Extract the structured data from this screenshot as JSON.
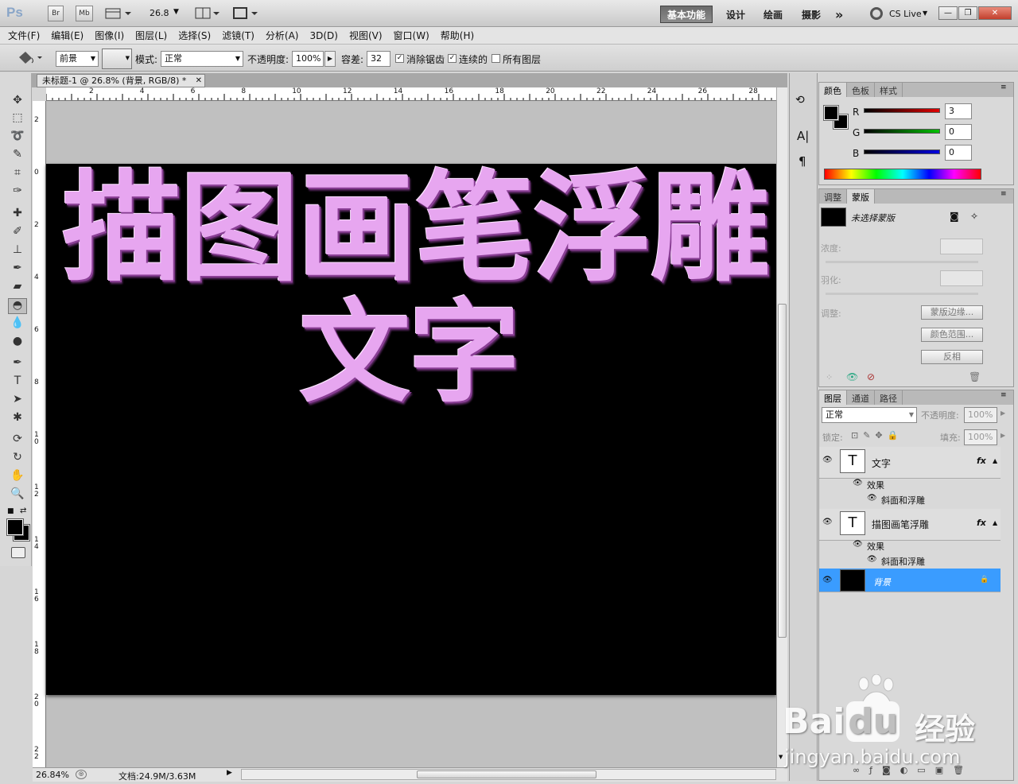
{
  "app": {
    "logo": "Ps",
    "bridge_btn": "Br",
    "minibridge_btn": "Mb",
    "zoom": "26.8",
    "workspaces": [
      "基本功能",
      "设计",
      "绘画",
      "摄影"
    ],
    "more": "»",
    "cs_live": "CS Live",
    "window_controls": [
      "—",
      "❐",
      "✕"
    ]
  },
  "menus": [
    "文件(F)",
    "编辑(E)",
    "图像(I)",
    "图层(L)",
    "选择(S)",
    "滤镜(T)",
    "分析(A)",
    "3D(D)",
    "视图(V)",
    "窗口(W)",
    "帮助(H)"
  ],
  "options": {
    "fill_source": "前景",
    "mode_label": "模式:",
    "mode_value": "正常",
    "opacity_label": "不透明度:",
    "opacity_value": "100%",
    "tolerance_label": "容差:",
    "tolerance_value": "32",
    "antialias_label": "消除锯齿",
    "contiguous_label": "连续的",
    "all_layers_label": "所有图层"
  },
  "document": {
    "tab_title": "未标题-1 @ 26.8% (背景, RGB/8) *",
    "ruler_top": [
      "2",
      "4",
      "6",
      "8",
      "10",
      "12",
      "14",
      "16",
      "18",
      "20",
      "22",
      "24",
      "26",
      "28"
    ],
    "ruler_left": [
      "2",
      "0",
      "2",
      "4",
      "6",
      "8",
      "1 0",
      "1 2",
      "1 4",
      "1 6",
      "1 8",
      "2 0",
      "2 2"
    ],
    "line1": "描图画笔浮雕",
    "line2": "文字",
    "zoom_status": "26.84%",
    "doc_size": "文档:24.9M/3.63M"
  },
  "color_panel": {
    "tabs": [
      "颜色",
      "色板",
      "样式"
    ],
    "channels": [
      {
        "label": "R",
        "value": "3",
        "color": "#e00000"
      },
      {
        "label": "G",
        "value": "0",
        "color": "#00c000"
      },
      {
        "label": "B",
        "value": "0",
        "color": "#0000e0"
      }
    ]
  },
  "mask_panel": {
    "tabs": [
      "调整",
      "蒙版"
    ],
    "title": "未选择蒙版",
    "density_label": "浓度:",
    "feather_label": "羽化:",
    "adjust_label": "调整:",
    "buttons": [
      "蒙版边缘...",
      "颜色范围...",
      "反相"
    ]
  },
  "layers_panel": {
    "tabs": [
      "图层",
      "通道",
      "路径"
    ],
    "blend_mode": "正常",
    "opacity_label": "不透明度:",
    "opacity_value": "100%",
    "lock_label": "锁定:",
    "fill_label": "填充:",
    "fill_value": "100%",
    "layers": [
      {
        "name": "文字",
        "effects_label": "效果",
        "effect": "斜面和浮雕"
      },
      {
        "name": "描图画笔浮雕",
        "effects_label": "效果",
        "effect": "斜面和浮雕"
      },
      {
        "name": "背景"
      }
    ],
    "fx": "fx"
  },
  "watermark": {
    "brand": "Bai",
    "brand2": "du",
    "cn": "经验",
    "url": "jingyan.baidu.com"
  }
}
